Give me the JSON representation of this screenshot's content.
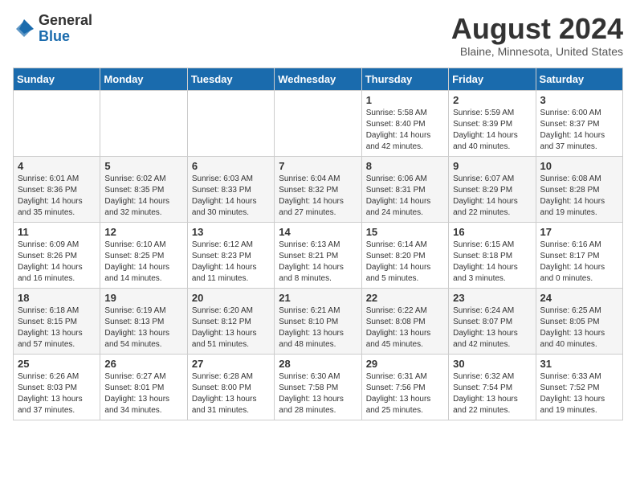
{
  "header": {
    "logo_general": "General",
    "logo_blue": "Blue",
    "month_title": "August 2024",
    "location": "Blaine, Minnesota, United States"
  },
  "weekdays": [
    "Sunday",
    "Monday",
    "Tuesday",
    "Wednesday",
    "Thursday",
    "Friday",
    "Saturday"
  ],
  "weeks": [
    [
      {
        "day": "",
        "info": ""
      },
      {
        "day": "",
        "info": ""
      },
      {
        "day": "",
        "info": ""
      },
      {
        "day": "",
        "info": ""
      },
      {
        "day": "1",
        "info": "Sunrise: 5:58 AM\nSunset: 8:40 PM\nDaylight: 14 hours\nand 42 minutes."
      },
      {
        "day": "2",
        "info": "Sunrise: 5:59 AM\nSunset: 8:39 PM\nDaylight: 14 hours\nand 40 minutes."
      },
      {
        "day": "3",
        "info": "Sunrise: 6:00 AM\nSunset: 8:37 PM\nDaylight: 14 hours\nand 37 minutes."
      }
    ],
    [
      {
        "day": "4",
        "info": "Sunrise: 6:01 AM\nSunset: 8:36 PM\nDaylight: 14 hours\nand 35 minutes."
      },
      {
        "day": "5",
        "info": "Sunrise: 6:02 AM\nSunset: 8:35 PM\nDaylight: 14 hours\nand 32 minutes."
      },
      {
        "day": "6",
        "info": "Sunrise: 6:03 AM\nSunset: 8:33 PM\nDaylight: 14 hours\nand 30 minutes."
      },
      {
        "day": "7",
        "info": "Sunrise: 6:04 AM\nSunset: 8:32 PM\nDaylight: 14 hours\nand 27 minutes."
      },
      {
        "day": "8",
        "info": "Sunrise: 6:06 AM\nSunset: 8:31 PM\nDaylight: 14 hours\nand 24 minutes."
      },
      {
        "day": "9",
        "info": "Sunrise: 6:07 AM\nSunset: 8:29 PM\nDaylight: 14 hours\nand 22 minutes."
      },
      {
        "day": "10",
        "info": "Sunrise: 6:08 AM\nSunset: 8:28 PM\nDaylight: 14 hours\nand 19 minutes."
      }
    ],
    [
      {
        "day": "11",
        "info": "Sunrise: 6:09 AM\nSunset: 8:26 PM\nDaylight: 14 hours\nand 16 minutes."
      },
      {
        "day": "12",
        "info": "Sunrise: 6:10 AM\nSunset: 8:25 PM\nDaylight: 14 hours\nand 14 minutes."
      },
      {
        "day": "13",
        "info": "Sunrise: 6:12 AM\nSunset: 8:23 PM\nDaylight: 14 hours\nand 11 minutes."
      },
      {
        "day": "14",
        "info": "Sunrise: 6:13 AM\nSunset: 8:21 PM\nDaylight: 14 hours\nand 8 minutes."
      },
      {
        "day": "15",
        "info": "Sunrise: 6:14 AM\nSunset: 8:20 PM\nDaylight: 14 hours\nand 5 minutes."
      },
      {
        "day": "16",
        "info": "Sunrise: 6:15 AM\nSunset: 8:18 PM\nDaylight: 14 hours\nand 3 minutes."
      },
      {
        "day": "17",
        "info": "Sunrise: 6:16 AM\nSunset: 8:17 PM\nDaylight: 14 hours\nand 0 minutes."
      }
    ],
    [
      {
        "day": "18",
        "info": "Sunrise: 6:18 AM\nSunset: 8:15 PM\nDaylight: 13 hours\nand 57 minutes."
      },
      {
        "day": "19",
        "info": "Sunrise: 6:19 AM\nSunset: 8:13 PM\nDaylight: 13 hours\nand 54 minutes."
      },
      {
        "day": "20",
        "info": "Sunrise: 6:20 AM\nSunset: 8:12 PM\nDaylight: 13 hours\nand 51 minutes."
      },
      {
        "day": "21",
        "info": "Sunrise: 6:21 AM\nSunset: 8:10 PM\nDaylight: 13 hours\nand 48 minutes."
      },
      {
        "day": "22",
        "info": "Sunrise: 6:22 AM\nSunset: 8:08 PM\nDaylight: 13 hours\nand 45 minutes."
      },
      {
        "day": "23",
        "info": "Sunrise: 6:24 AM\nSunset: 8:07 PM\nDaylight: 13 hours\nand 42 minutes."
      },
      {
        "day": "24",
        "info": "Sunrise: 6:25 AM\nSunset: 8:05 PM\nDaylight: 13 hours\nand 40 minutes."
      }
    ],
    [
      {
        "day": "25",
        "info": "Sunrise: 6:26 AM\nSunset: 8:03 PM\nDaylight: 13 hours\nand 37 minutes."
      },
      {
        "day": "26",
        "info": "Sunrise: 6:27 AM\nSunset: 8:01 PM\nDaylight: 13 hours\nand 34 minutes."
      },
      {
        "day": "27",
        "info": "Sunrise: 6:28 AM\nSunset: 8:00 PM\nDaylight: 13 hours\nand 31 minutes."
      },
      {
        "day": "28",
        "info": "Sunrise: 6:30 AM\nSunset: 7:58 PM\nDaylight: 13 hours\nand 28 minutes."
      },
      {
        "day": "29",
        "info": "Sunrise: 6:31 AM\nSunset: 7:56 PM\nDaylight: 13 hours\nand 25 minutes."
      },
      {
        "day": "30",
        "info": "Sunrise: 6:32 AM\nSunset: 7:54 PM\nDaylight: 13 hours\nand 22 minutes."
      },
      {
        "day": "31",
        "info": "Sunrise: 6:33 AM\nSunset: 7:52 PM\nDaylight: 13 hours\nand 19 minutes."
      }
    ]
  ]
}
